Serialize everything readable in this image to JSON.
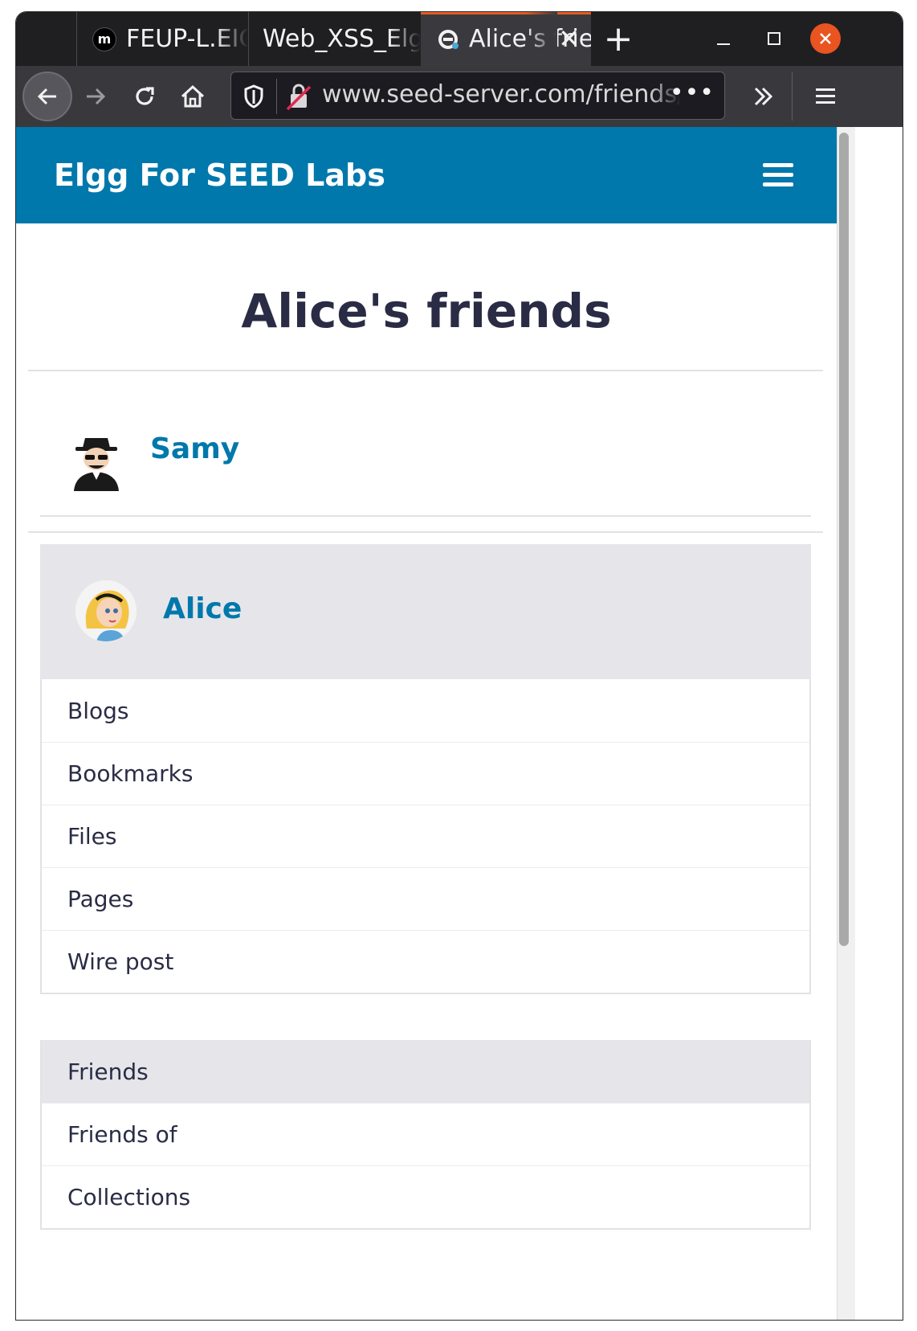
{
  "browser": {
    "tabs": [
      {
        "label": "FEUP-L.EIC",
        "active": false
      },
      {
        "label": "Web_XSS_Elgg",
        "active": false
      },
      {
        "label": "Alice's friends",
        "active": true
      }
    ],
    "url": "www.seed-server.com/friends/alice",
    "colors": {
      "tab_accent": "#e65c22",
      "close_button": "#e95420"
    }
  },
  "site": {
    "brand": "Elgg For SEED Labs",
    "header_color": "#0078ac"
  },
  "main": {
    "title": "Alice's friends",
    "friends": [
      {
        "name": "Samy",
        "avatar": "spy-avatar"
      }
    ]
  },
  "owner_block": {
    "name": "Alice",
    "avatar": "alice-avatar",
    "menu": [
      "Blogs",
      "Bookmarks",
      "Files",
      "Pages",
      "Wire post"
    ]
  },
  "friends_menu": {
    "items": [
      "Friends",
      "Friends of",
      "Collections"
    ],
    "selected": "Friends"
  }
}
